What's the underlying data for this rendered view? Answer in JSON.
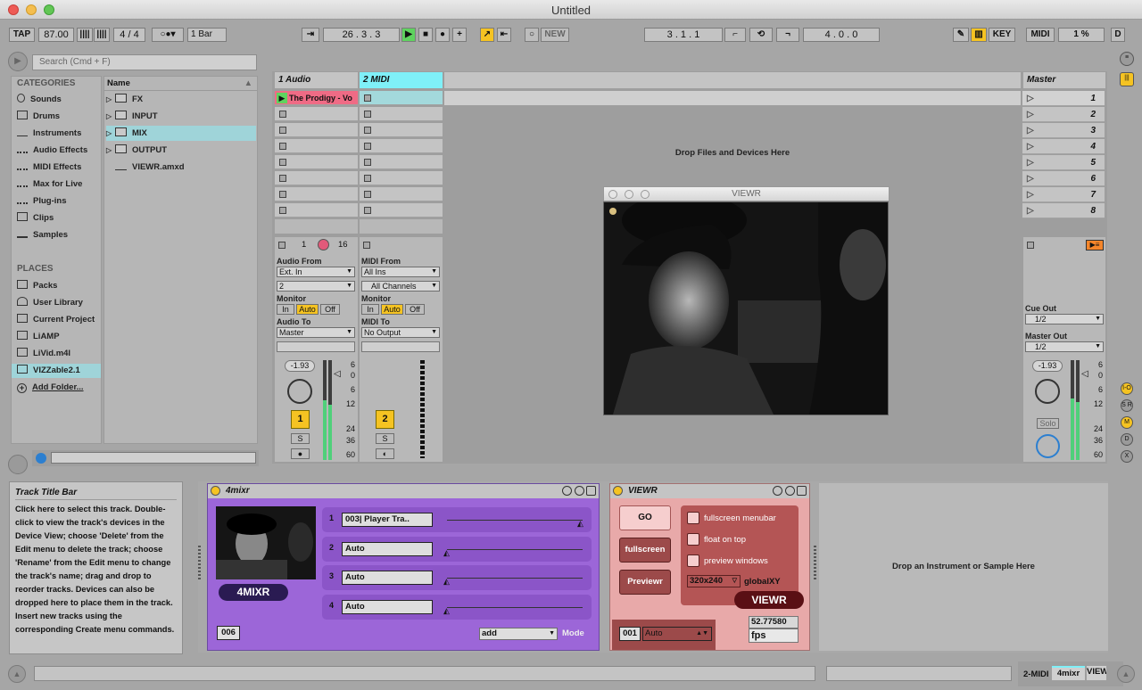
{
  "window": {
    "title": "Untitled"
  },
  "transport": {
    "tap": "TAP",
    "tempo": "87.00",
    "time_sig": "4 / 4",
    "quantize": "1 Bar",
    "position": "26 .  3 .  3",
    "new": "NEW",
    "loop_start": "3 .  1 .  1",
    "loop_len": "4 .  0 .  0",
    "key": "KEY",
    "midi": "MIDI",
    "cpu": "1 %",
    "d": "D"
  },
  "browser": {
    "search_placeholder": "Search (Cmd + F)",
    "categories_title": "CATEGORIES",
    "categories": [
      "Sounds",
      "Drums",
      "Instruments",
      "Audio Effects",
      "MIDI Effects",
      "Max for Live",
      "Plug-ins",
      "Clips",
      "Samples"
    ],
    "places_title": "PLACES",
    "places": [
      "Packs",
      "User Library",
      "Current Project",
      "LiAMP",
      "LiVid.m4l",
      "VIZZable2.1"
    ],
    "add_folder": "Add Folder...",
    "name_header": "Name",
    "files": [
      "FX",
      "INPUT",
      "MIX",
      "OUTPUT",
      "VIEWR.amxd"
    ]
  },
  "tracks": {
    "audio": {
      "name": "1 Audio",
      "clip": "The Prodigy - Vo",
      "num": "1",
      "send": "16",
      "audio_from_label": "Audio From",
      "audio_from": "Ext. In",
      "channel": "2",
      "monitor_label": "Monitor",
      "monitor": [
        "In",
        "Auto",
        "Off"
      ],
      "audio_to_label": "Audio To",
      "audio_to": "Master",
      "volume": "-1.93",
      "track_num": "1",
      "solo": "S"
    },
    "midi": {
      "name": "2 MIDI",
      "midi_from_label": "MIDI From",
      "midi_from": "All Ins",
      "channel": "All Channels",
      "monitor_label": "Monitor",
      "monitor": [
        "In",
        "Auto",
        "Off"
      ],
      "midi_to_label": "MIDI To",
      "midi_to": "No Output",
      "track_num": "2",
      "solo": "S"
    },
    "master": {
      "name": "Master",
      "scenes": [
        "1",
        "2",
        "3",
        "4",
        "5",
        "6",
        "7",
        "8"
      ],
      "cue_out_label": "Cue Out",
      "cue_out": "1/2",
      "master_out_label": "Master Out",
      "master_out": "1/2",
      "volume": "-1.93",
      "solo": "Solo"
    },
    "drop_hint": "Drop Files and Devices Here",
    "db_scale": [
      "6",
      "0",
      "6",
      "12",
      "24",
      "36",
      "60"
    ]
  },
  "viewr_window": {
    "title": "VIEWR"
  },
  "info_panel": {
    "title": "Track Title Bar",
    "body": "Click here to select this track. Double-click to view the track's devices in the Device View; choose 'Delete' from the Edit menu to delete the track; choose 'Rename' from the Edit menu to change the track's name; drag and drop to reorder tracks. Devices can also be dropped here to place them in the track. Insert new tracks using the corresponding Create menu commands."
  },
  "device_4mixr": {
    "title": "4mixr",
    "logo": "4MIXR",
    "id": "006",
    "rows": [
      {
        "n": "1",
        "src": "003| Player Tra.."
      },
      {
        "n": "2",
        "src": "Auto"
      },
      {
        "n": "3",
        "src": "Auto"
      },
      {
        "n": "4",
        "src": "Auto"
      }
    ],
    "mode_value": "add",
    "mode_label": "Mode"
  },
  "device_viewr": {
    "title": "VIEWR",
    "go": "GO",
    "fullscreen": "fullscreen",
    "previewr": "Previewr",
    "opt_menubar": "fullscreen menubar",
    "opt_float": "float on top",
    "opt_preview": "preview windows",
    "res": "320x240",
    "globalxy": "globalXY",
    "logo": "VIEWR",
    "id": "001",
    "src": "Auto",
    "fps_value": "52.77580",
    "fps_label": "fps"
  },
  "instrument_drop": "Drop an Instrument or Sample Here",
  "status": {
    "track1": "2-MIDI",
    "track2": "4mixr",
    "track3": "VIEW"
  }
}
